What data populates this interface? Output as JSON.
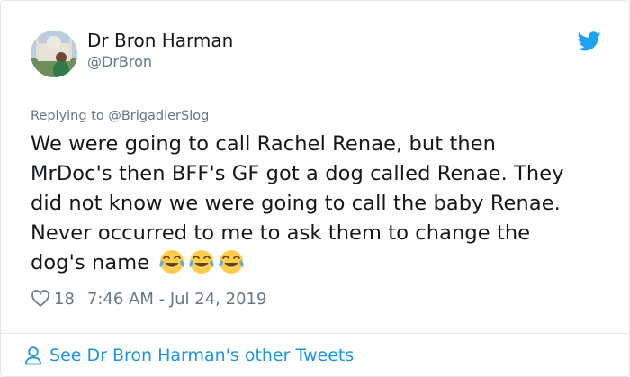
{
  "tweet": {
    "author": {
      "display_name": "Dr Bron Harman",
      "handle": "@DrBron",
      "avatar_icon": "profile-photo"
    },
    "reply_line": "Replying to @BrigadierSlog",
    "text_lines": [
      "We were going to call Rachel Renae, but then",
      "MrDoc's then BFF's GF got a dog called Renae. They",
      "did not know we were going to call the baby Renae.",
      "Never occurred to me to ask them to change the",
      "dog's name"
    ],
    "emojis": [
      "face-with-tears-of-joy",
      "face-with-tears-of-joy",
      "face-with-tears-of-joy"
    ],
    "like_count": "18",
    "timestamp": "7:46 AM - Jul 24, 2019",
    "footer_link": "See Dr Bron Harman's other Tweets"
  },
  "colors": {
    "accent": "#1da1f2",
    "link": "#1b95e0",
    "secondary_text": "#657786",
    "primary_text": "#14171a",
    "border": "#e1e8ed"
  },
  "icons": {
    "brand": "twitter-bird-icon",
    "like": "heart-icon",
    "footer": "person-icon"
  }
}
